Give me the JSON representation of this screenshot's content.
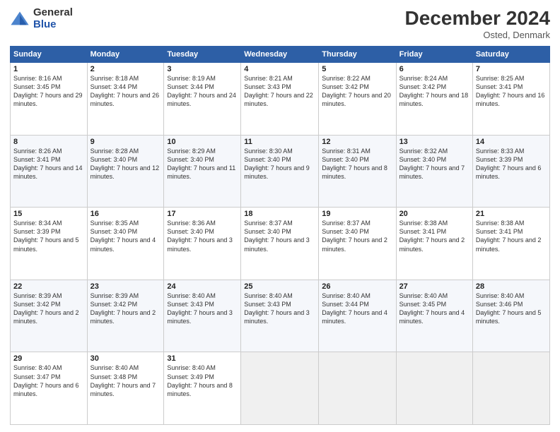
{
  "logo": {
    "general": "General",
    "blue": "Blue"
  },
  "header": {
    "month": "December 2024",
    "location": "Osted, Denmark"
  },
  "weekdays": [
    "Sunday",
    "Monday",
    "Tuesday",
    "Wednesday",
    "Thursday",
    "Friday",
    "Saturday"
  ],
  "weeks": [
    [
      {
        "day": "1",
        "sunrise": "8:16 AM",
        "sunset": "3:45 PM",
        "daylight": "7 hours and 29 minutes."
      },
      {
        "day": "2",
        "sunrise": "8:18 AM",
        "sunset": "3:44 PM",
        "daylight": "7 hours and 26 minutes."
      },
      {
        "day": "3",
        "sunrise": "8:19 AM",
        "sunset": "3:44 PM",
        "daylight": "7 hours and 24 minutes."
      },
      {
        "day": "4",
        "sunrise": "8:21 AM",
        "sunset": "3:43 PM",
        "daylight": "7 hours and 22 minutes."
      },
      {
        "day": "5",
        "sunrise": "8:22 AM",
        "sunset": "3:42 PM",
        "daylight": "7 hours and 20 minutes."
      },
      {
        "day": "6",
        "sunrise": "8:24 AM",
        "sunset": "3:42 PM",
        "daylight": "7 hours and 18 minutes."
      },
      {
        "day": "7",
        "sunrise": "8:25 AM",
        "sunset": "3:41 PM",
        "daylight": "7 hours and 16 minutes."
      }
    ],
    [
      {
        "day": "8",
        "sunrise": "8:26 AM",
        "sunset": "3:41 PM",
        "daylight": "7 hours and 14 minutes."
      },
      {
        "day": "9",
        "sunrise": "8:28 AM",
        "sunset": "3:40 PM",
        "daylight": "7 hours and 12 minutes."
      },
      {
        "day": "10",
        "sunrise": "8:29 AM",
        "sunset": "3:40 PM",
        "daylight": "7 hours and 11 minutes."
      },
      {
        "day": "11",
        "sunrise": "8:30 AM",
        "sunset": "3:40 PM",
        "daylight": "7 hours and 9 minutes."
      },
      {
        "day": "12",
        "sunrise": "8:31 AM",
        "sunset": "3:40 PM",
        "daylight": "7 hours and 8 minutes."
      },
      {
        "day": "13",
        "sunrise": "8:32 AM",
        "sunset": "3:40 PM",
        "daylight": "7 hours and 7 minutes."
      },
      {
        "day": "14",
        "sunrise": "8:33 AM",
        "sunset": "3:39 PM",
        "daylight": "7 hours and 6 minutes."
      }
    ],
    [
      {
        "day": "15",
        "sunrise": "8:34 AM",
        "sunset": "3:39 PM",
        "daylight": "7 hours and 5 minutes."
      },
      {
        "day": "16",
        "sunrise": "8:35 AM",
        "sunset": "3:40 PM",
        "daylight": "7 hours and 4 minutes."
      },
      {
        "day": "17",
        "sunrise": "8:36 AM",
        "sunset": "3:40 PM",
        "daylight": "7 hours and 3 minutes."
      },
      {
        "day": "18",
        "sunrise": "8:37 AM",
        "sunset": "3:40 PM",
        "daylight": "7 hours and 3 minutes."
      },
      {
        "day": "19",
        "sunrise": "8:37 AM",
        "sunset": "3:40 PM",
        "daylight": "7 hours and 2 minutes."
      },
      {
        "day": "20",
        "sunrise": "8:38 AM",
        "sunset": "3:41 PM",
        "daylight": "7 hours and 2 minutes."
      },
      {
        "day": "21",
        "sunrise": "8:38 AM",
        "sunset": "3:41 PM",
        "daylight": "7 hours and 2 minutes."
      }
    ],
    [
      {
        "day": "22",
        "sunrise": "8:39 AM",
        "sunset": "3:42 PM",
        "daylight": "7 hours and 2 minutes."
      },
      {
        "day": "23",
        "sunrise": "8:39 AM",
        "sunset": "3:42 PM",
        "daylight": "7 hours and 2 minutes."
      },
      {
        "day": "24",
        "sunrise": "8:40 AM",
        "sunset": "3:43 PM",
        "daylight": "7 hours and 3 minutes."
      },
      {
        "day": "25",
        "sunrise": "8:40 AM",
        "sunset": "3:43 PM",
        "daylight": "7 hours and 3 minutes."
      },
      {
        "day": "26",
        "sunrise": "8:40 AM",
        "sunset": "3:44 PM",
        "daylight": "7 hours and 4 minutes."
      },
      {
        "day": "27",
        "sunrise": "8:40 AM",
        "sunset": "3:45 PM",
        "daylight": "7 hours and 4 minutes."
      },
      {
        "day": "28",
        "sunrise": "8:40 AM",
        "sunset": "3:46 PM",
        "daylight": "7 hours and 5 minutes."
      }
    ],
    [
      {
        "day": "29",
        "sunrise": "8:40 AM",
        "sunset": "3:47 PM",
        "daylight": "7 hours and 6 minutes."
      },
      {
        "day": "30",
        "sunrise": "8:40 AM",
        "sunset": "3:48 PM",
        "daylight": "7 hours and 7 minutes."
      },
      {
        "day": "31",
        "sunrise": "8:40 AM",
        "sunset": "3:49 PM",
        "daylight": "7 hours and 8 minutes."
      },
      null,
      null,
      null,
      null
    ]
  ]
}
